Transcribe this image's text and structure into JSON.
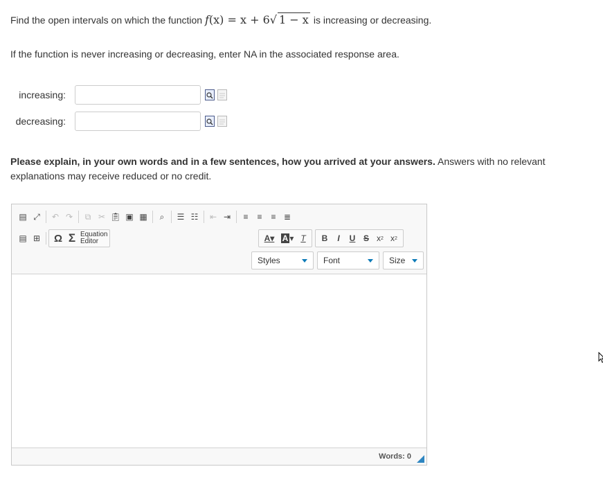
{
  "question": {
    "prefix": "Find the open intervals on which the function",
    "math_lhs": "f",
    "math_arg": "(x) = x + 6",
    "math_radicand": "1 − x",
    "suffix": "is increasing or decreasing."
  },
  "note": "If the function is never increasing or decreasing, enter NA in the associated response area.",
  "fields": [
    {
      "label": "increasing:",
      "value": "",
      "placeholder": ""
    },
    {
      "label": "decreasing:",
      "value": "",
      "placeholder": ""
    }
  ],
  "explain": {
    "bold": "Please explain, in your own words and in a few sentences, how you arrived at your answers.",
    "normal": "Answers with no relevant explanations may receive reduced or no credit."
  },
  "editor": {
    "equation_line1": "Equation",
    "equation_line2": "Editor",
    "omega": "Ω",
    "sigma": "Σ",
    "styles_label": "Styles",
    "font_label": "Font",
    "size_label": "Size",
    "words_label": "Words: 0",
    "content": ""
  },
  "colors": {
    "accent": "#0e7bb8",
    "border": "#c8c8c8",
    "toolbar_bg": "#f8f8f8"
  }
}
